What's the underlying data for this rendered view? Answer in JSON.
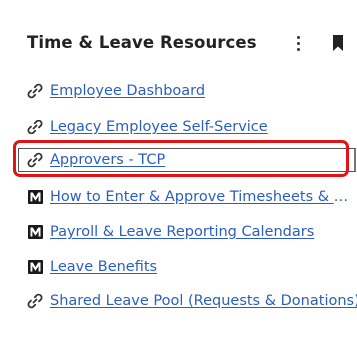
{
  "panel": {
    "title": "Time & Leave Resources",
    "menu_icon": "kebab-menu-icon",
    "bookmark_icon": "bookmark-icon"
  },
  "links": [
    {
      "label": "Employee Dashboard",
      "icon": "link-icon"
    },
    {
      "label": "Legacy Employee Self-Service",
      "icon": "link-icon"
    },
    {
      "label": "Approvers - TCP",
      "icon": "link-icon"
    },
    {
      "label": "How to Enter & Approve Timesheets & Leav...",
      "icon": "m-badge-icon"
    },
    {
      "label": "Payroll & Leave Reporting Calendars",
      "icon": "m-badge-icon"
    },
    {
      "label": "Leave Benefits",
      "icon": "m-badge-icon"
    },
    {
      "label": "Shared Leave Pool (Requests & Donations)",
      "icon": "link-icon"
    }
  ],
  "colors": {
    "link": "#2a5fbf",
    "highlight": "#e01414",
    "badge": "#1a1a1a"
  }
}
